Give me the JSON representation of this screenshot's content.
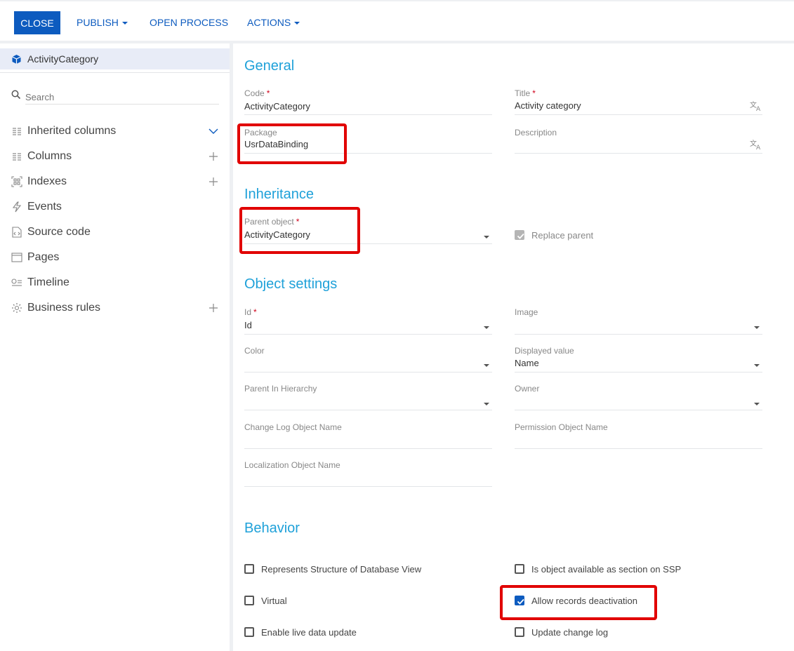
{
  "toolbar": {
    "close": "CLOSE",
    "publish": "PUBLISH",
    "open_process": "OPEN PROCESS",
    "actions": "ACTIONS"
  },
  "sidebar": {
    "object_name": "ActivityCategory",
    "search_placeholder": "Search",
    "items": [
      {
        "label": "Inherited columns",
        "action": "chevron-down-icon"
      },
      {
        "label": "Columns",
        "action": "plus-icon"
      },
      {
        "label": "Indexes",
        "action": "plus-icon"
      },
      {
        "label": "Events",
        "action": ""
      },
      {
        "label": "Source code",
        "action": ""
      },
      {
        "label": "Pages",
        "action": ""
      },
      {
        "label": "Timeline",
        "action": ""
      },
      {
        "label": "Business rules",
        "action": "plus-icon"
      }
    ]
  },
  "general": {
    "title": "General",
    "code_label": "Code",
    "code_value": "ActivityCategory",
    "title_label": "Title",
    "title_value": "Activity category",
    "package_label": "Package",
    "package_value": "UsrDataBinding",
    "description_label": "Description",
    "description_value": ""
  },
  "inheritance": {
    "title": "Inheritance",
    "parent_label": "Parent object",
    "parent_value": "ActivityCategory",
    "replace_parent": "Replace parent",
    "replace_parent_checked": true
  },
  "object_settings": {
    "title": "Object settings",
    "id_label": "Id",
    "id_value": "Id",
    "image_label": "Image",
    "image_value": "",
    "color_label": "Color",
    "color_value": "",
    "displayed_label": "Displayed value",
    "displayed_value": "Name",
    "parent_hierarchy_label": "Parent In Hierarchy",
    "owner_label": "Owner",
    "change_log_label": "Change Log Object Name",
    "permission_label": "Permission Object Name",
    "localization_label": "Localization Object Name"
  },
  "behavior": {
    "title": "Behavior",
    "represents_db_view": "Represents Structure of Database View",
    "available_ssp": "Is object available as section on SSP",
    "virtual": "Virtual",
    "allow_deactivation": "Allow records deactivation",
    "allow_deactivation_checked": true,
    "live_update": "Enable live data update",
    "update_change_log": "Update change log"
  },
  "colors": {
    "accent": "#0d5bbf",
    "section_title": "#1fa1d9",
    "highlight": "#e10000",
    "required": "#d0021b"
  }
}
